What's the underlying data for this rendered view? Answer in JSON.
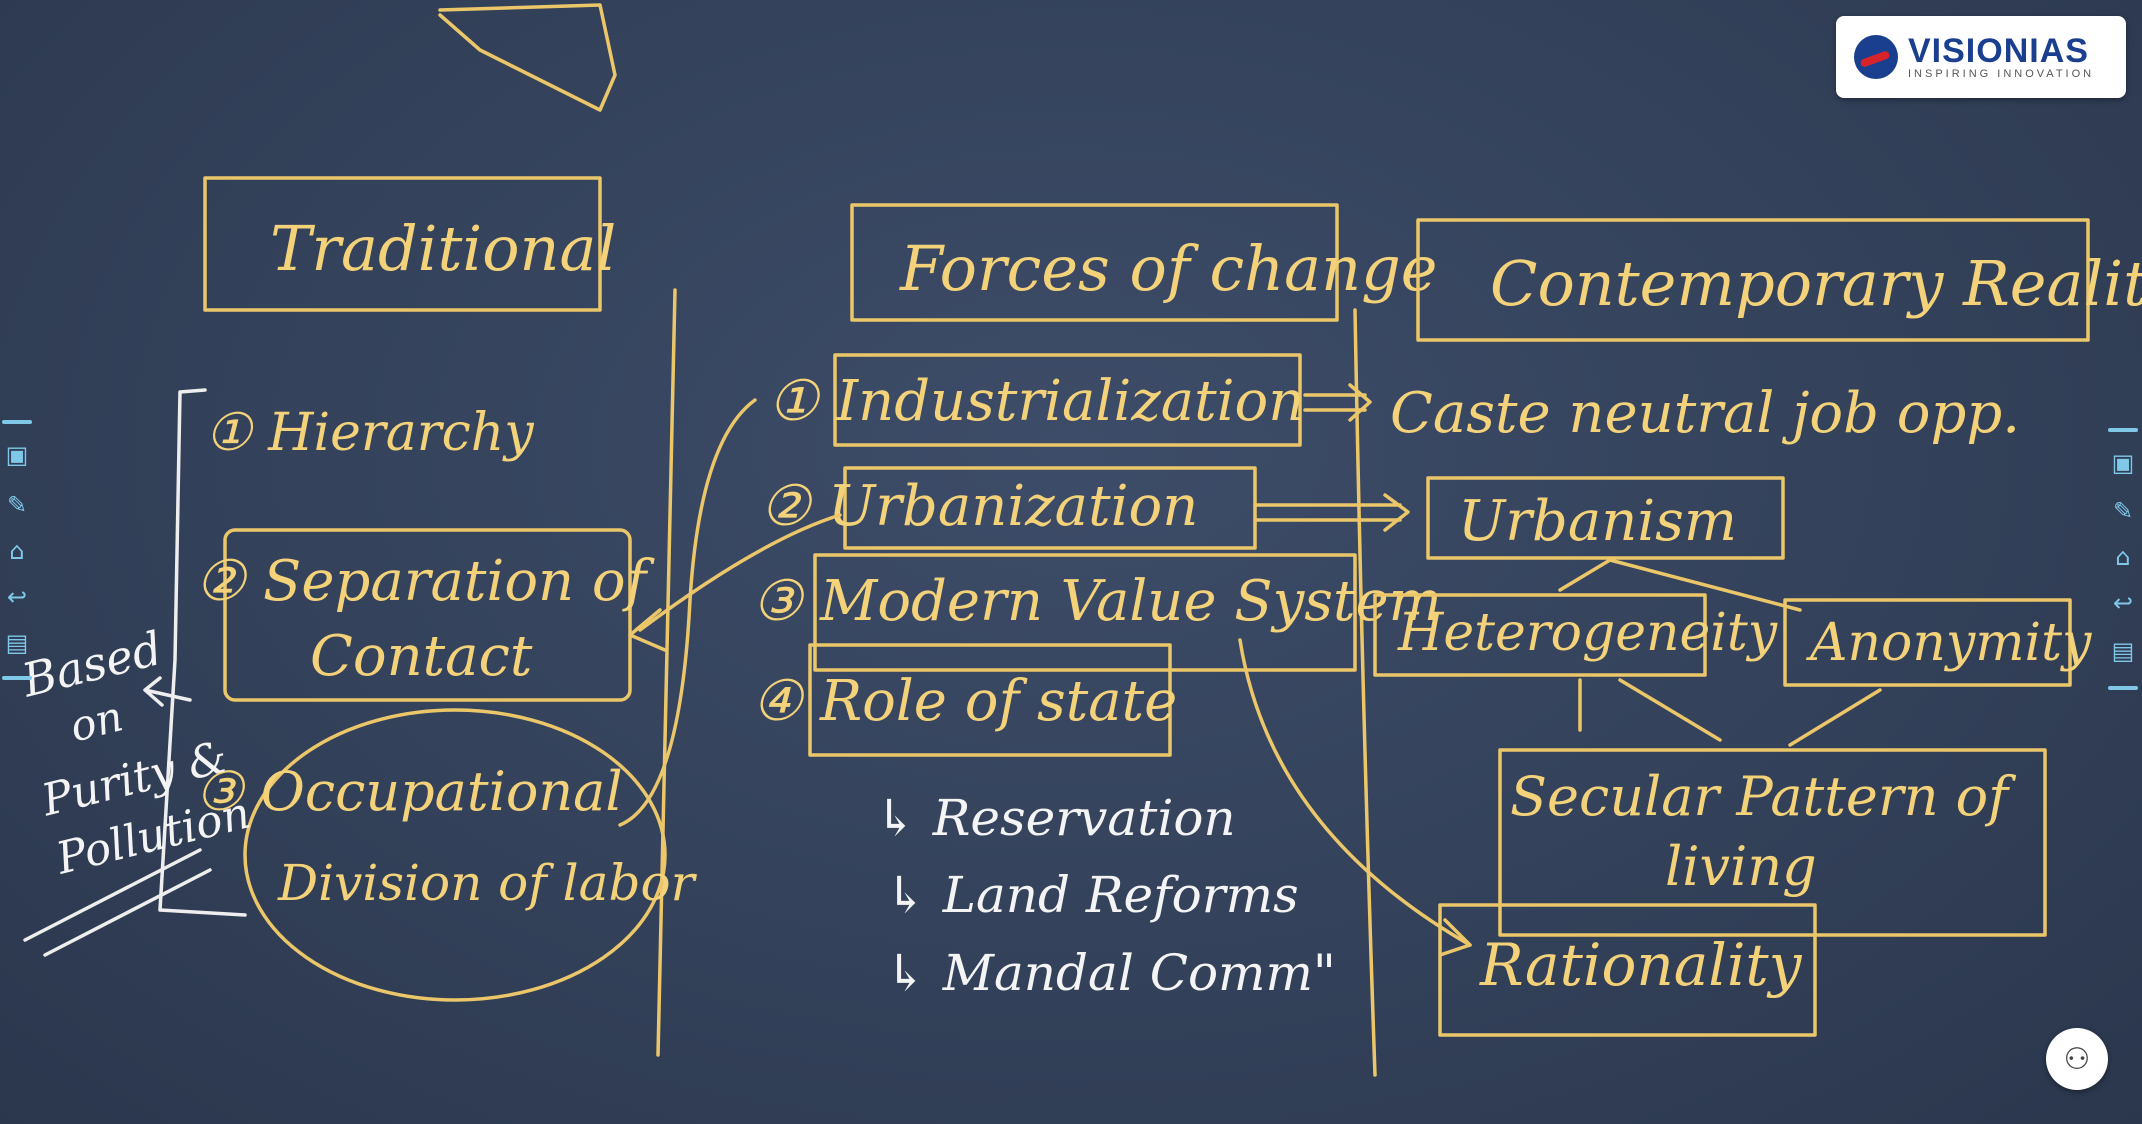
{
  "logo": {
    "name": "VISIONIAS",
    "tagline": "INSPIRING INNOVATION"
  },
  "board": {
    "traditional": {
      "title": "Traditional",
      "items": [
        "① Hierarchy",
        "② Separation of",
        "Contact",
        "③ Occupational",
        "Division of labor"
      ],
      "side_note": [
        "Based",
        "on",
        "Purity &",
        "Pollution"
      ]
    },
    "forces": {
      "title": "Forces of change",
      "items": [
        "① Industrialization",
        "② Urbanization",
        "③ Modern Value System",
        "④ Role of state"
      ],
      "sub_items": [
        "↳ Reservation",
        "↳ Land Reforms",
        "↳ Mandal Comm\""
      ]
    },
    "contemporary": {
      "title": "Contemporary Reality",
      "caste_note": "Caste neutral job opp.",
      "urbanism": "Urbanism",
      "heterogeneity": "Heterogeneity",
      "anonymity": "Anonymity",
      "secular": [
        "Secular Pattern of",
        "living"
      ],
      "rationality": "Rationality"
    }
  },
  "toolbar": {
    "icons": [
      "screen-icon",
      "pen-icon",
      "home-icon",
      "undo-icon",
      "present-icon"
    ],
    "accent": "#7fc8e8"
  },
  "colors": {
    "chalk_yellow": "#f3d27a",
    "chalk_white": "#f4f4f4",
    "board": "#33415a"
  }
}
